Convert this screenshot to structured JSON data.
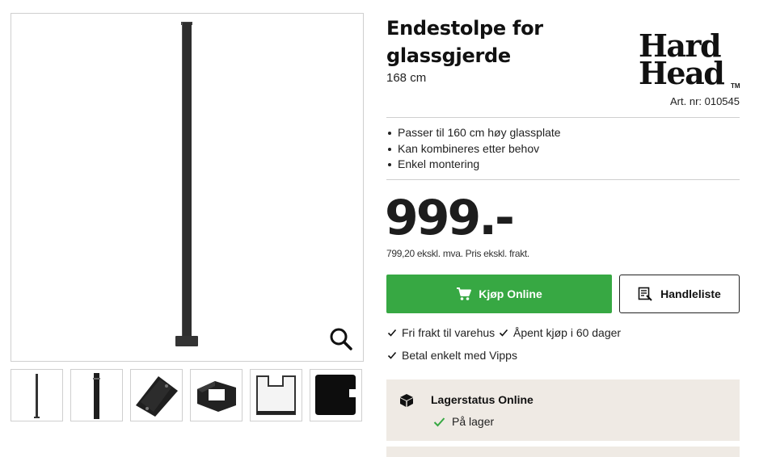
{
  "product": {
    "title": "Endestolpe for glassgjerde",
    "subtitle": "168 cm",
    "art_nr": "Art. nr: 010545"
  },
  "brand": {
    "line1": "Hard",
    "line2": "Head",
    "tm": "TM"
  },
  "features": [
    "Passer til 160 cm høy glassplate",
    "Kan kombineres etter behov",
    "Enkel montering"
  ],
  "price": {
    "amount": "999.-",
    "note": "799,20 ekskl. mva. Pris ekskl. frakt."
  },
  "actions": {
    "buy_label": "Kjøp Online",
    "list_label": "Handleliste"
  },
  "usps": [
    "Fri frakt til varehus",
    "Åpent kjøp i 60 dager",
    "Betal enkelt med Vipps"
  ],
  "stock": {
    "title": "Lagerstatus Online",
    "status": "På lager"
  },
  "colors": {
    "buy_button": "#37a843",
    "stock_bg": "#efeae4",
    "in_stock_check": "#37a843"
  },
  "icons": {
    "zoom": "magnifier-icon",
    "cart": "cart-icon",
    "list": "shopping-list-icon",
    "usp": "check-icon",
    "stock": "box-icon"
  }
}
